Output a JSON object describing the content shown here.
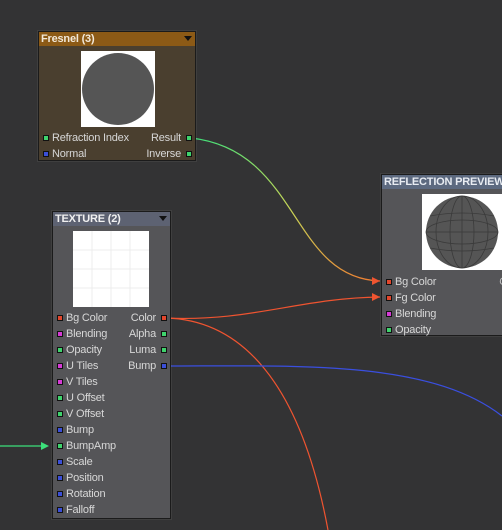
{
  "fresnel": {
    "title": "Fresnel (3)",
    "inputs": [
      "Refraction Index",
      "Normal"
    ],
    "outputs": [
      "Result",
      "Inverse"
    ]
  },
  "texture": {
    "title": "TEXTURE (2)",
    "inputs": [
      "Bg Color",
      "Blending",
      "Opacity",
      "U Tiles",
      "V Tiles",
      "U Offset",
      "V Offset",
      "Bump",
      "BumpAmp",
      "Scale",
      "Position",
      "Rotation",
      "Falloff"
    ],
    "outputs": [
      "Color",
      "Alpha",
      "Luma",
      "Bump"
    ]
  },
  "reflection": {
    "title": "REFLECTION PREVIEW",
    "inputs": [
      "Bg Color",
      "Fg Color",
      "Blending",
      "Opacity"
    ],
    "output_partial": "C"
  },
  "colors": {
    "canvas": "#333334",
    "fresnel_header": "#8c5a16",
    "fresnel_body": "#4a3f2f",
    "texture_header": "#5d6272",
    "reflection_header": "#5d6a80",
    "node_body": "#555558",
    "wire_red": "#f05430",
    "wire_blue": "#3a4fe0",
    "wire_green": "#3ce07a"
  }
}
